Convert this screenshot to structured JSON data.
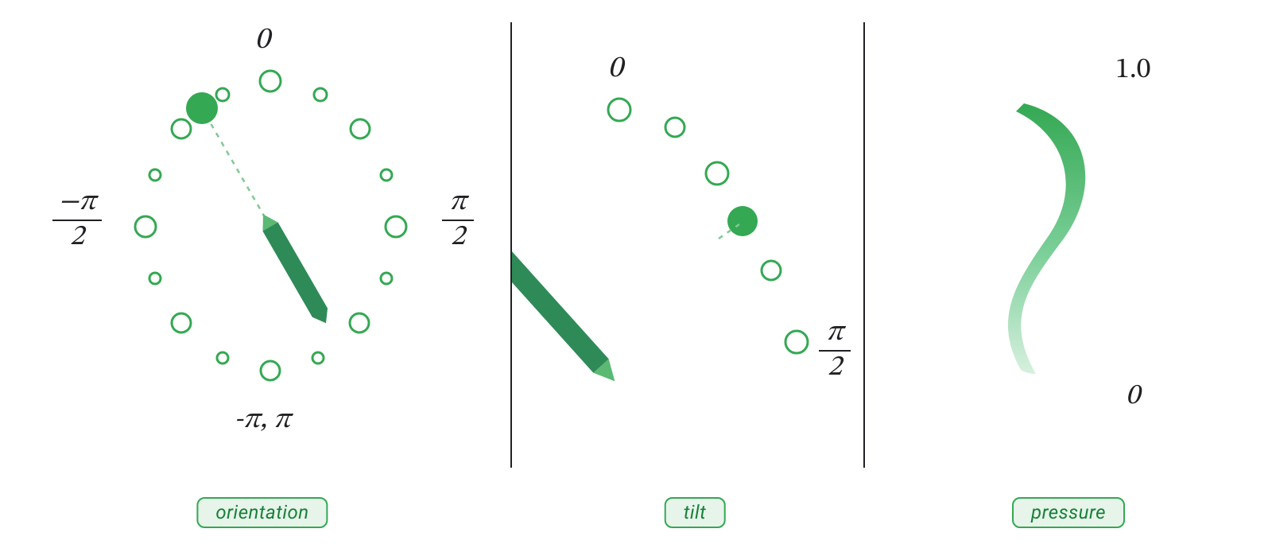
{
  "colors": {
    "green_dark": "#2e8b57",
    "green_mid": "#34a853",
    "green_light": "#5bb974",
    "green_pale": "#e6f4ea",
    "ink": "#202124"
  },
  "panels": {
    "orientation": {
      "label": "orientation",
      "top_label": "0",
      "bottom_label": "-π, π",
      "left_top": "−π",
      "left_bottom": "2",
      "right_top": "π",
      "right_bottom": "2",
      "indicator_angle_deg": -30
    },
    "tilt": {
      "label": "tilt",
      "top_label": "0",
      "right_top": "π",
      "right_bottom": "2",
      "indicator_tilt_deg": 45
    },
    "pressure": {
      "label": "pressure",
      "max_label": "1.0",
      "min_label": "0",
      "range": [
        0,
        1.0
      ]
    }
  },
  "chart_data": [
    {
      "type": "gauge",
      "name": "orientation",
      "range_radians": [
        -3.14159,
        3.14159
      ],
      "tick_labels": [
        "0",
        "π/2",
        "-π, π",
        "-π/2"
      ],
      "value_radians": -0.5236
    },
    {
      "type": "gauge",
      "name": "tilt",
      "range_radians": [
        0,
        1.5708
      ],
      "tick_labels": [
        "0",
        "π/2"
      ],
      "value_radians": 0.7854
    },
    {
      "type": "scale",
      "name": "pressure",
      "range": [
        0,
        1.0
      ],
      "tick_labels": [
        "0",
        "1.0"
      ]
    }
  ]
}
